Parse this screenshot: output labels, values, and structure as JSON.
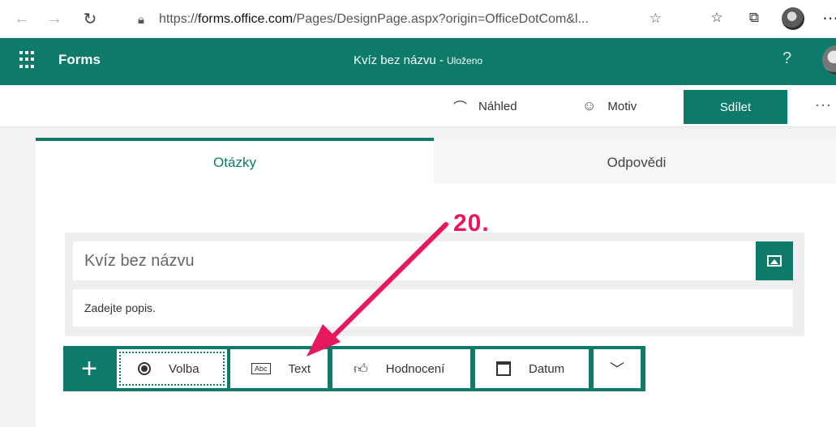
{
  "browser": {
    "url_prefix": "https://",
    "url_host": "forms.office.com",
    "url_path": "/Pages/DesignPage.aspx?origin=OfficeDotCom&l..."
  },
  "header": {
    "app_name": "Forms",
    "doc_title": "Kvíz bez názvu",
    "separator": " - ",
    "saved_status": "Uloženo",
    "help": "?"
  },
  "commands": {
    "preview": "Náhled",
    "theme": "Motiv",
    "share": "Sdílet",
    "more": "···"
  },
  "tabs": {
    "questions": "Otázky",
    "responses": "Odpovědi"
  },
  "form": {
    "title": "Kvíz bez názvu",
    "description_placeholder": "Zadejte popis."
  },
  "toolbar": {
    "add": "+",
    "types": [
      "Volba",
      "Text",
      "Hodnocení",
      "Datum"
    ],
    "chevron": "﹀"
  },
  "annotation": {
    "label": "20.",
    "color": "#e8185f"
  },
  "colors": {
    "accent": "#0d7a6a"
  }
}
